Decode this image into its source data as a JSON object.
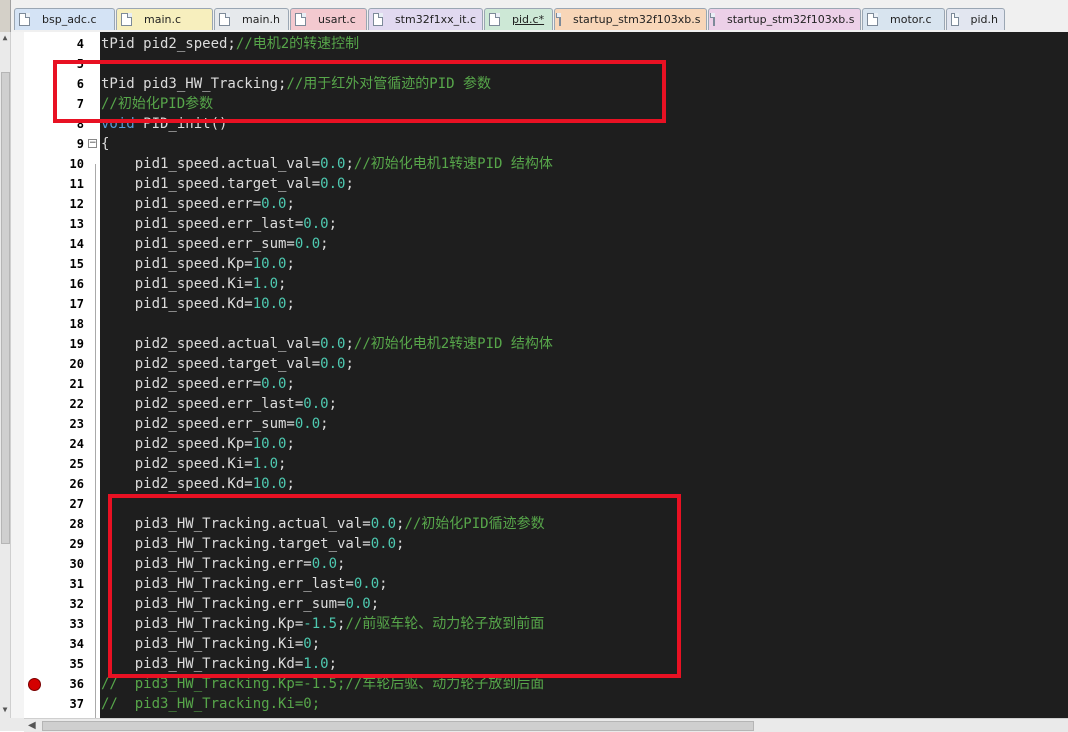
{
  "tabs": [
    {
      "label": "bsp_adc.c",
      "color": "#d4e3f5",
      "active": false
    },
    {
      "label": "main.c",
      "color": "#f7efbe",
      "active": false
    },
    {
      "label": "main.h",
      "color": "#e6e9ec",
      "active": false
    },
    {
      "label": "usart.c",
      "color": "#f3c9cf",
      "active": false
    },
    {
      "label": "stm32f1xx_it.c",
      "color": "#e1d9f0",
      "active": false
    },
    {
      "label": "pid.c*",
      "color": "#cde8d6",
      "active": true
    },
    {
      "label": "startup_stm32f103xb.s",
      "color": "#f8d6b8",
      "active": false
    },
    {
      "label": "startup_stm32f103xb.s",
      "color": "#ecd0e8",
      "active": false
    },
    {
      "label": "motor.c",
      "color": "#d8e4ef",
      "active": false
    },
    {
      "label": "pid.h",
      "color": "#e2e6f0",
      "active": false
    }
  ],
  "lines": [
    {
      "n": "4",
      "code": [
        [
          "ty",
          "tPid pid2_speed;"
        ],
        [
          "cmt",
          "//电机2的转速控制"
        ]
      ]
    },
    {
      "n": "5",
      "code": []
    },
    {
      "n": "6",
      "code": [
        [
          "ty",
          "tPid pid3_HW_Tracking;"
        ],
        [
          "cmt",
          "//用于红外对管循迹的PID 参数"
        ]
      ]
    },
    {
      "n": "7",
      "code": [
        [
          "cmt",
          "//初始化PID参数"
        ]
      ]
    },
    {
      "n": "8",
      "code": [
        [
          "kw",
          "void"
        ],
        [
          "ty",
          " PID_init()"
        ]
      ]
    },
    {
      "n": "9",
      "code": [
        [
          "ty",
          "{"
        ]
      ]
    },
    {
      "n": "10",
      "code": [
        [
          "ty",
          "    pid1_speed.actual_val="
        ],
        [
          "num",
          "0.0"
        ],
        [
          "ty",
          ";"
        ],
        [
          "cmt",
          "//初始化电机1转速PID 结构体"
        ]
      ]
    },
    {
      "n": "11",
      "code": [
        [
          "ty",
          "    pid1_speed.target_val="
        ],
        [
          "num",
          "0.0"
        ],
        [
          "ty",
          ";"
        ]
      ]
    },
    {
      "n": "12",
      "code": [
        [
          "ty",
          "    pid1_speed.err="
        ],
        [
          "num",
          "0.0"
        ],
        [
          "ty",
          ";"
        ]
      ]
    },
    {
      "n": "13",
      "code": [
        [
          "ty",
          "    pid1_speed.err_last="
        ],
        [
          "num",
          "0.0"
        ],
        [
          "ty",
          ";"
        ]
      ]
    },
    {
      "n": "14",
      "code": [
        [
          "ty",
          "    pid1_speed.err_sum="
        ],
        [
          "num",
          "0.0"
        ],
        [
          "ty",
          ";"
        ]
      ]
    },
    {
      "n": "15",
      "code": [
        [
          "ty",
          "    pid1_speed.Kp="
        ],
        [
          "num",
          "10.0"
        ],
        [
          "ty",
          ";"
        ]
      ]
    },
    {
      "n": "16",
      "code": [
        [
          "ty",
          "    pid1_speed.Ki="
        ],
        [
          "num",
          "1.0"
        ],
        [
          "ty",
          ";"
        ]
      ]
    },
    {
      "n": "17",
      "code": [
        [
          "ty",
          "    pid1_speed.Kd="
        ],
        [
          "num",
          "10.0"
        ],
        [
          "ty",
          ";"
        ]
      ]
    },
    {
      "n": "18",
      "code": []
    },
    {
      "n": "19",
      "code": [
        [
          "ty",
          "    pid2_speed.actual_val="
        ],
        [
          "num",
          "0.0"
        ],
        [
          "ty",
          ";"
        ],
        [
          "cmt",
          "//初始化电机2转速PID 结构体"
        ]
      ]
    },
    {
      "n": "20",
      "code": [
        [
          "ty",
          "    pid2_speed.target_val="
        ],
        [
          "num",
          "0.0"
        ],
        [
          "ty",
          ";"
        ]
      ]
    },
    {
      "n": "21",
      "code": [
        [
          "ty",
          "    pid2_speed.err="
        ],
        [
          "num",
          "0.0"
        ],
        [
          "ty",
          ";"
        ]
      ]
    },
    {
      "n": "22",
      "code": [
        [
          "ty",
          "    pid2_speed.err_last="
        ],
        [
          "num",
          "0.0"
        ],
        [
          "ty",
          ";"
        ]
      ]
    },
    {
      "n": "23",
      "code": [
        [
          "ty",
          "    pid2_speed.err_sum="
        ],
        [
          "num",
          "0.0"
        ],
        [
          "ty",
          ";"
        ]
      ]
    },
    {
      "n": "24",
      "code": [
        [
          "ty",
          "    pid2_speed.Kp="
        ],
        [
          "num",
          "10.0"
        ],
        [
          "ty",
          ";"
        ]
      ]
    },
    {
      "n": "25",
      "code": [
        [
          "ty",
          "    pid2_speed.Ki="
        ],
        [
          "num",
          "1.0"
        ],
        [
          "ty",
          ";"
        ]
      ]
    },
    {
      "n": "26",
      "code": [
        [
          "ty",
          "    pid2_speed.Kd="
        ],
        [
          "num",
          "10.0"
        ],
        [
          "ty",
          ";"
        ]
      ]
    },
    {
      "n": "27",
      "code": []
    },
    {
      "n": "28",
      "code": [
        [
          "ty",
          "    pid3_HW_Tracking.actual_val="
        ],
        [
          "num",
          "0.0"
        ],
        [
          "ty",
          ";"
        ],
        [
          "cmt",
          "//初始化PID循迹参数"
        ]
      ]
    },
    {
      "n": "29",
      "code": [
        [
          "ty",
          "    pid3_HW_Tracking.target_val="
        ],
        [
          "num",
          "0.0"
        ],
        [
          "ty",
          ";"
        ]
      ]
    },
    {
      "n": "30",
      "code": [
        [
          "ty",
          "    pid3_HW_Tracking.err="
        ],
        [
          "num",
          "0.0"
        ],
        [
          "ty",
          ";"
        ]
      ]
    },
    {
      "n": "31",
      "code": [
        [
          "ty",
          "    pid3_HW_Tracking.err_last="
        ],
        [
          "num",
          "0.0"
        ],
        [
          "ty",
          ";"
        ]
      ]
    },
    {
      "n": "32",
      "code": [
        [
          "ty",
          "    pid3_HW_Tracking.err_sum="
        ],
        [
          "num",
          "0.0"
        ],
        [
          "ty",
          ";"
        ]
      ]
    },
    {
      "n": "33",
      "code": [
        [
          "ty",
          "    pid3_HW_Tracking.Kp="
        ],
        [
          "num",
          "-1.5"
        ],
        [
          "ty",
          ";"
        ],
        [
          "cmt",
          "//前驱车轮、动力轮子放到前面"
        ]
      ]
    },
    {
      "n": "34",
      "code": [
        [
          "ty",
          "    pid3_HW_Tracking.Ki="
        ],
        [
          "num",
          "0"
        ],
        [
          "ty",
          ";"
        ]
      ]
    },
    {
      "n": "35",
      "code": [
        [
          "ty",
          "    pid3_HW_Tracking.Kd="
        ],
        [
          "num",
          "1.0"
        ],
        [
          "ty",
          ";"
        ]
      ]
    },
    {
      "n": "36",
      "code": [
        [
          "cmt",
          "//  pid3_HW_Tracking.Kp=-1.5;//车轮后驱、动力轮子放到后面"
        ]
      ]
    },
    {
      "n": "37",
      "code": [
        [
          "cmt",
          "//  pid3_HW_Tracking.Ki=0;"
        ]
      ]
    }
  ],
  "colors": {
    "highlight": "#e81123",
    "editor_bg": "#1e1e1e",
    "breakpoint": "#d40000"
  }
}
